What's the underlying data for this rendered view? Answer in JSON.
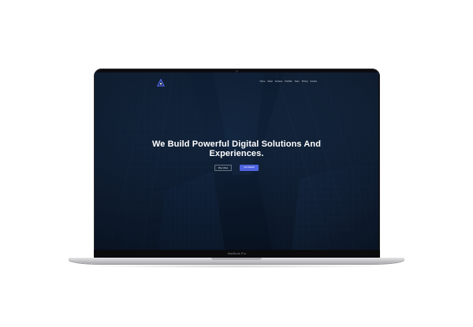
{
  "device": {
    "model_label": "MacBook Pro",
    "bezel_color": "#0c0c0f",
    "body_color": "#c9c9cc"
  },
  "site": {
    "logo_icon": "logo-mark-icon",
    "nav_items": [
      {
        "label": "Home"
      },
      {
        "label": "About"
      },
      {
        "label": "Services"
      },
      {
        "label": "Portfolio"
      },
      {
        "label": "Team"
      },
      {
        "label": "Pricing"
      },
      {
        "label": "Contact"
      }
    ],
    "hero": {
      "title_line1": "We Build Powerful Digital Solutions And",
      "title_line2": "Experiences.",
      "secondary_button": "Play Video",
      "primary_button": "Get Started"
    },
    "colors": {
      "accent": "#4f63e0",
      "background": "#0d1a2d",
      "text": "#ffffff"
    }
  }
}
